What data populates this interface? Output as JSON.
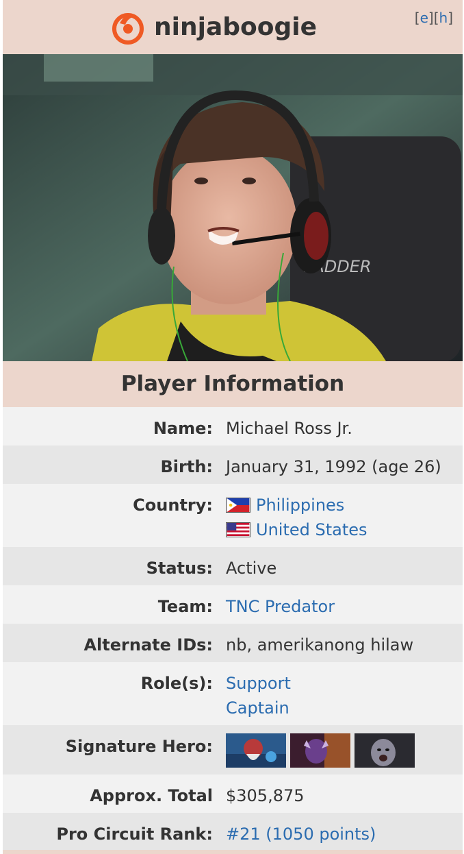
{
  "header": {
    "title": "ninjaboogie",
    "edit": "e",
    "history": "h"
  },
  "photo": {
    "alt": "Player photo: ninjaboogie at event wearing headset"
  },
  "section_title": "Player Information",
  "rows": {
    "name": {
      "label": "Name:",
      "value": "Michael Ross Jr."
    },
    "birth": {
      "label": "Birth:",
      "value": "January 31, 1992 (age 26)"
    },
    "country": {
      "label": "Country:",
      "values": [
        "Philippines",
        "United States"
      ]
    },
    "status": {
      "label": "Status:",
      "value": "Active"
    },
    "team": {
      "label": "Team:",
      "value": "TNC Predator"
    },
    "alternate_ids": {
      "label": "Alternate IDs:",
      "value": "nb, amerikanong hilaw"
    },
    "roles": {
      "label": "Role(s):",
      "values": [
        "Support",
        "Captain"
      ]
    },
    "signature_hero": {
      "label": "Signature Hero:"
    },
    "earnings": {
      "label": "Approx. Total Earnings:",
      "value": "$305,875"
    },
    "pro_circuit": {
      "label": "Pro Circuit Rank:",
      "value": "#21 (1050 points)"
    }
  },
  "colors": {
    "header_bg": "#ecd6cc",
    "link": "#2b6cb0",
    "row_alt": "#e6e6e6"
  }
}
